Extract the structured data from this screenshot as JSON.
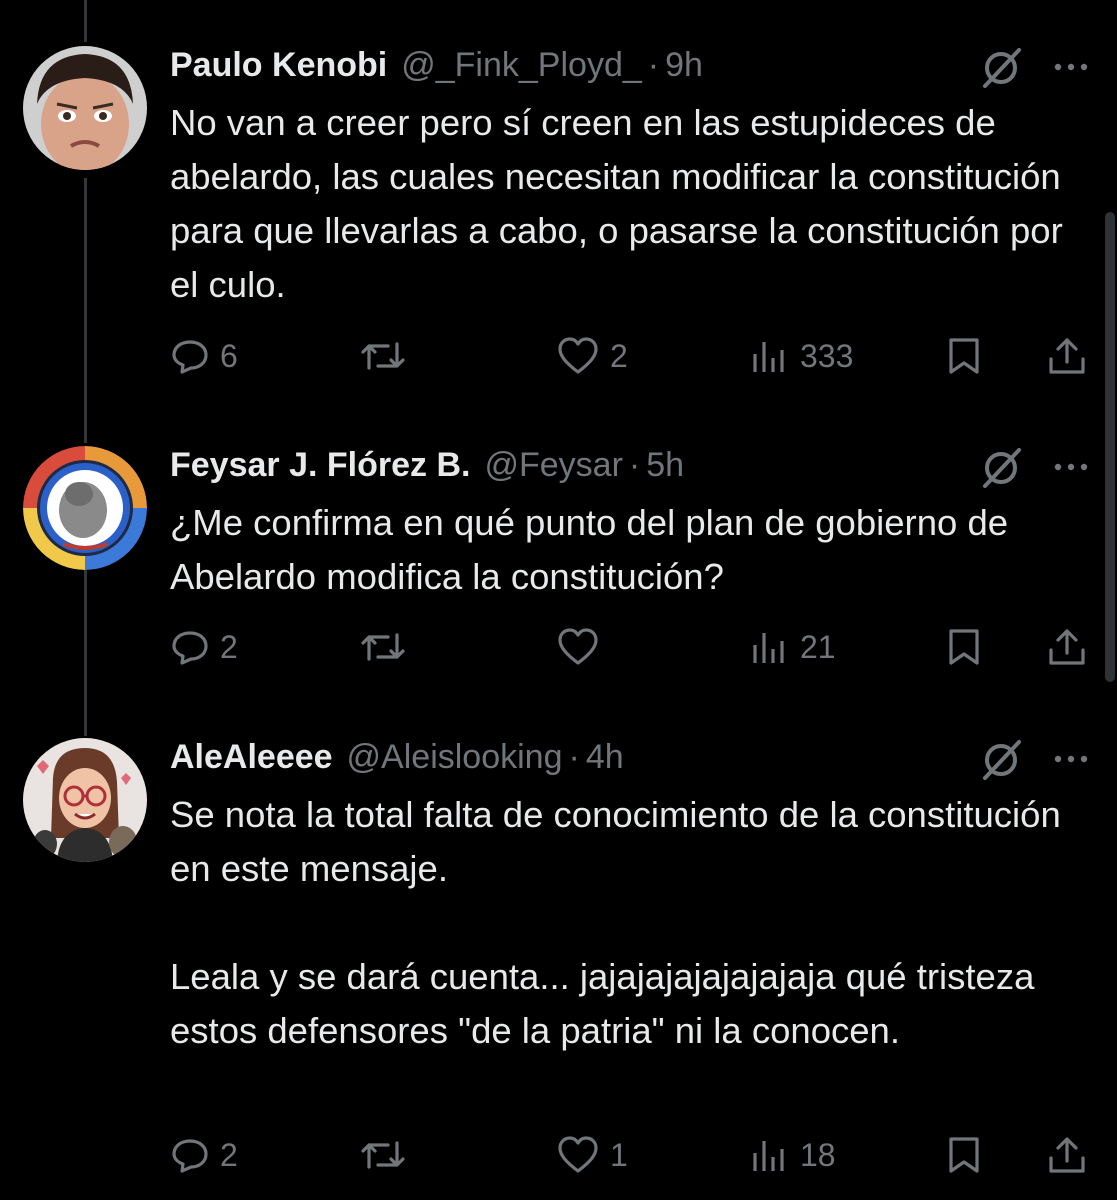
{
  "tweets": [
    {
      "name": "Paulo Kenobi",
      "handle": "@_Fink_Ployd_",
      "separator": "·",
      "time": "9h",
      "text": "No van a creer pero sí creen en las estupideces de abelardo, las cuales necesitan modificar la constitución para que llevarlas a cabo, o pasarse la constitución por el culo.",
      "replies": "6",
      "reposts": "",
      "likes": "2",
      "views": "333"
    },
    {
      "name": "Feysar J. Flórez B.",
      "handle": "@Feysar",
      "separator": "·",
      "time": "5h",
      "text": "¿Me confirma en qué punto del plan de gobierno de  Abelardo modifica la constitución?",
      "replies": "2",
      "reposts": "",
      "likes": "",
      "views": "21"
    },
    {
      "name": "AleAleeee",
      "handle": "@Aleislooking",
      "separator": "·",
      "time": "4h",
      "text_paragraph_1": "Se nota la total falta de conocimiento de la constitución en este mensaje.",
      "text_paragraph_2": "Leala y se dará cuenta... jajajajajajajajaja qué tristeza estos defensores \"de la patria\" ni la conocen.",
      "replies": "2",
      "reposts": "",
      "likes": "1",
      "views": "18"
    }
  ],
  "icons": {
    "reply": "reply-icon",
    "repost": "repost-icon",
    "like": "like-icon",
    "views": "views-icon",
    "bookmark": "bookmark-icon",
    "share": "share-icon",
    "grok": "grok-icon",
    "more": "more-icon"
  },
  "colors": {
    "background": "#000000",
    "text": "#e7e9ea",
    "secondary": "#71767b",
    "thread_line": "#333639"
  }
}
